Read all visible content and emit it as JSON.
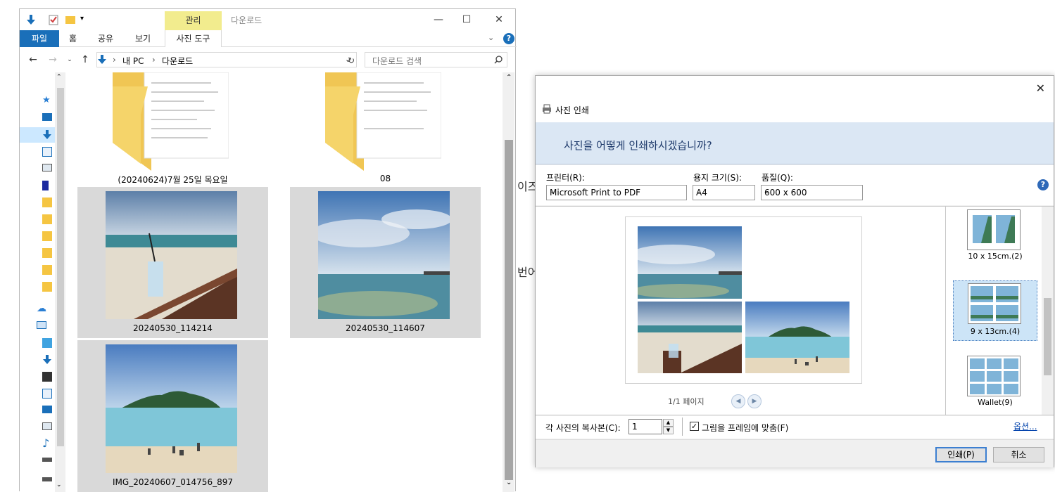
{
  "explorer": {
    "title": "다운로드",
    "context_tab": "관리",
    "ribbon_tabs": [
      "파일",
      "홈",
      "공유",
      "보기",
      "사진 도구"
    ],
    "address": [
      "내 PC",
      "다운로드"
    ],
    "search_placeholder": "다운로드 검색",
    "items": [
      {
        "name": "(20240624)7월 25일 목요일",
        "type": "folder"
      },
      {
        "name": "08",
        "type": "folder"
      },
      {
        "name": "20240530_114214",
        "type": "photo",
        "selected": true
      },
      {
        "name": "20240530_114607",
        "type": "photo",
        "selected": true
      },
      {
        "name": "IMG_20240607_014756_897",
        "type": "photo",
        "selected": true
      }
    ]
  },
  "background_text": [
    "이즈",
    "번어"
  ],
  "dialog": {
    "title": "사진 인쇄",
    "question": "사진을 어떻게 인쇄하시겠습니까?",
    "printer_label": "프린터(R):",
    "printer_value": "Microsoft Print to PDF",
    "paper_label": "용지 크기(S):",
    "paper_value": "A4",
    "quality_label": "품질(Q):",
    "quality_value": "600 x 600",
    "page_indicator": "1/1 페이지",
    "layouts": [
      {
        "label": "10 x 15cm.(2)",
        "selected": false
      },
      {
        "label": "9 x 13cm.(4)",
        "selected": true
      },
      {
        "label": "Wallet(9)",
        "selected": false
      }
    ],
    "copies_label": "각 사진의 복사본(C):",
    "copies_value": "1",
    "fit_label": "그림을 프레임에 맞춤(F)",
    "fit_checked": true,
    "options_link": "옵션...",
    "print_button": "인쇄(P)",
    "cancel_button": "취소"
  }
}
